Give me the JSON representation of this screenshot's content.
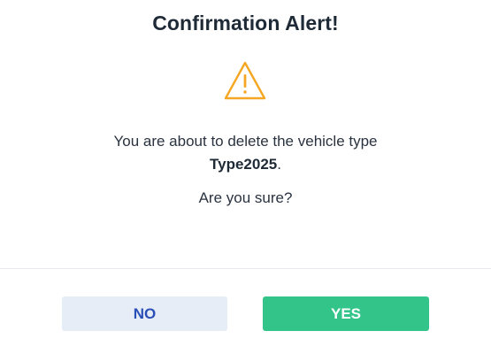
{
  "dialog": {
    "title": "Confirmation Alert!",
    "icon": "warning-triangle-icon",
    "message_line1": "You are about to delete the vehicle type",
    "item_name": "Type2025",
    "item_suffix": ".",
    "question": "Are you sure?",
    "no_label": "NO",
    "yes_label": "YES"
  },
  "colors": {
    "warning": "#f5a623",
    "no_bg": "#e6edf6",
    "no_text": "#2a4fb8",
    "yes_bg": "#33c48a",
    "yes_text": "#ffffff"
  }
}
